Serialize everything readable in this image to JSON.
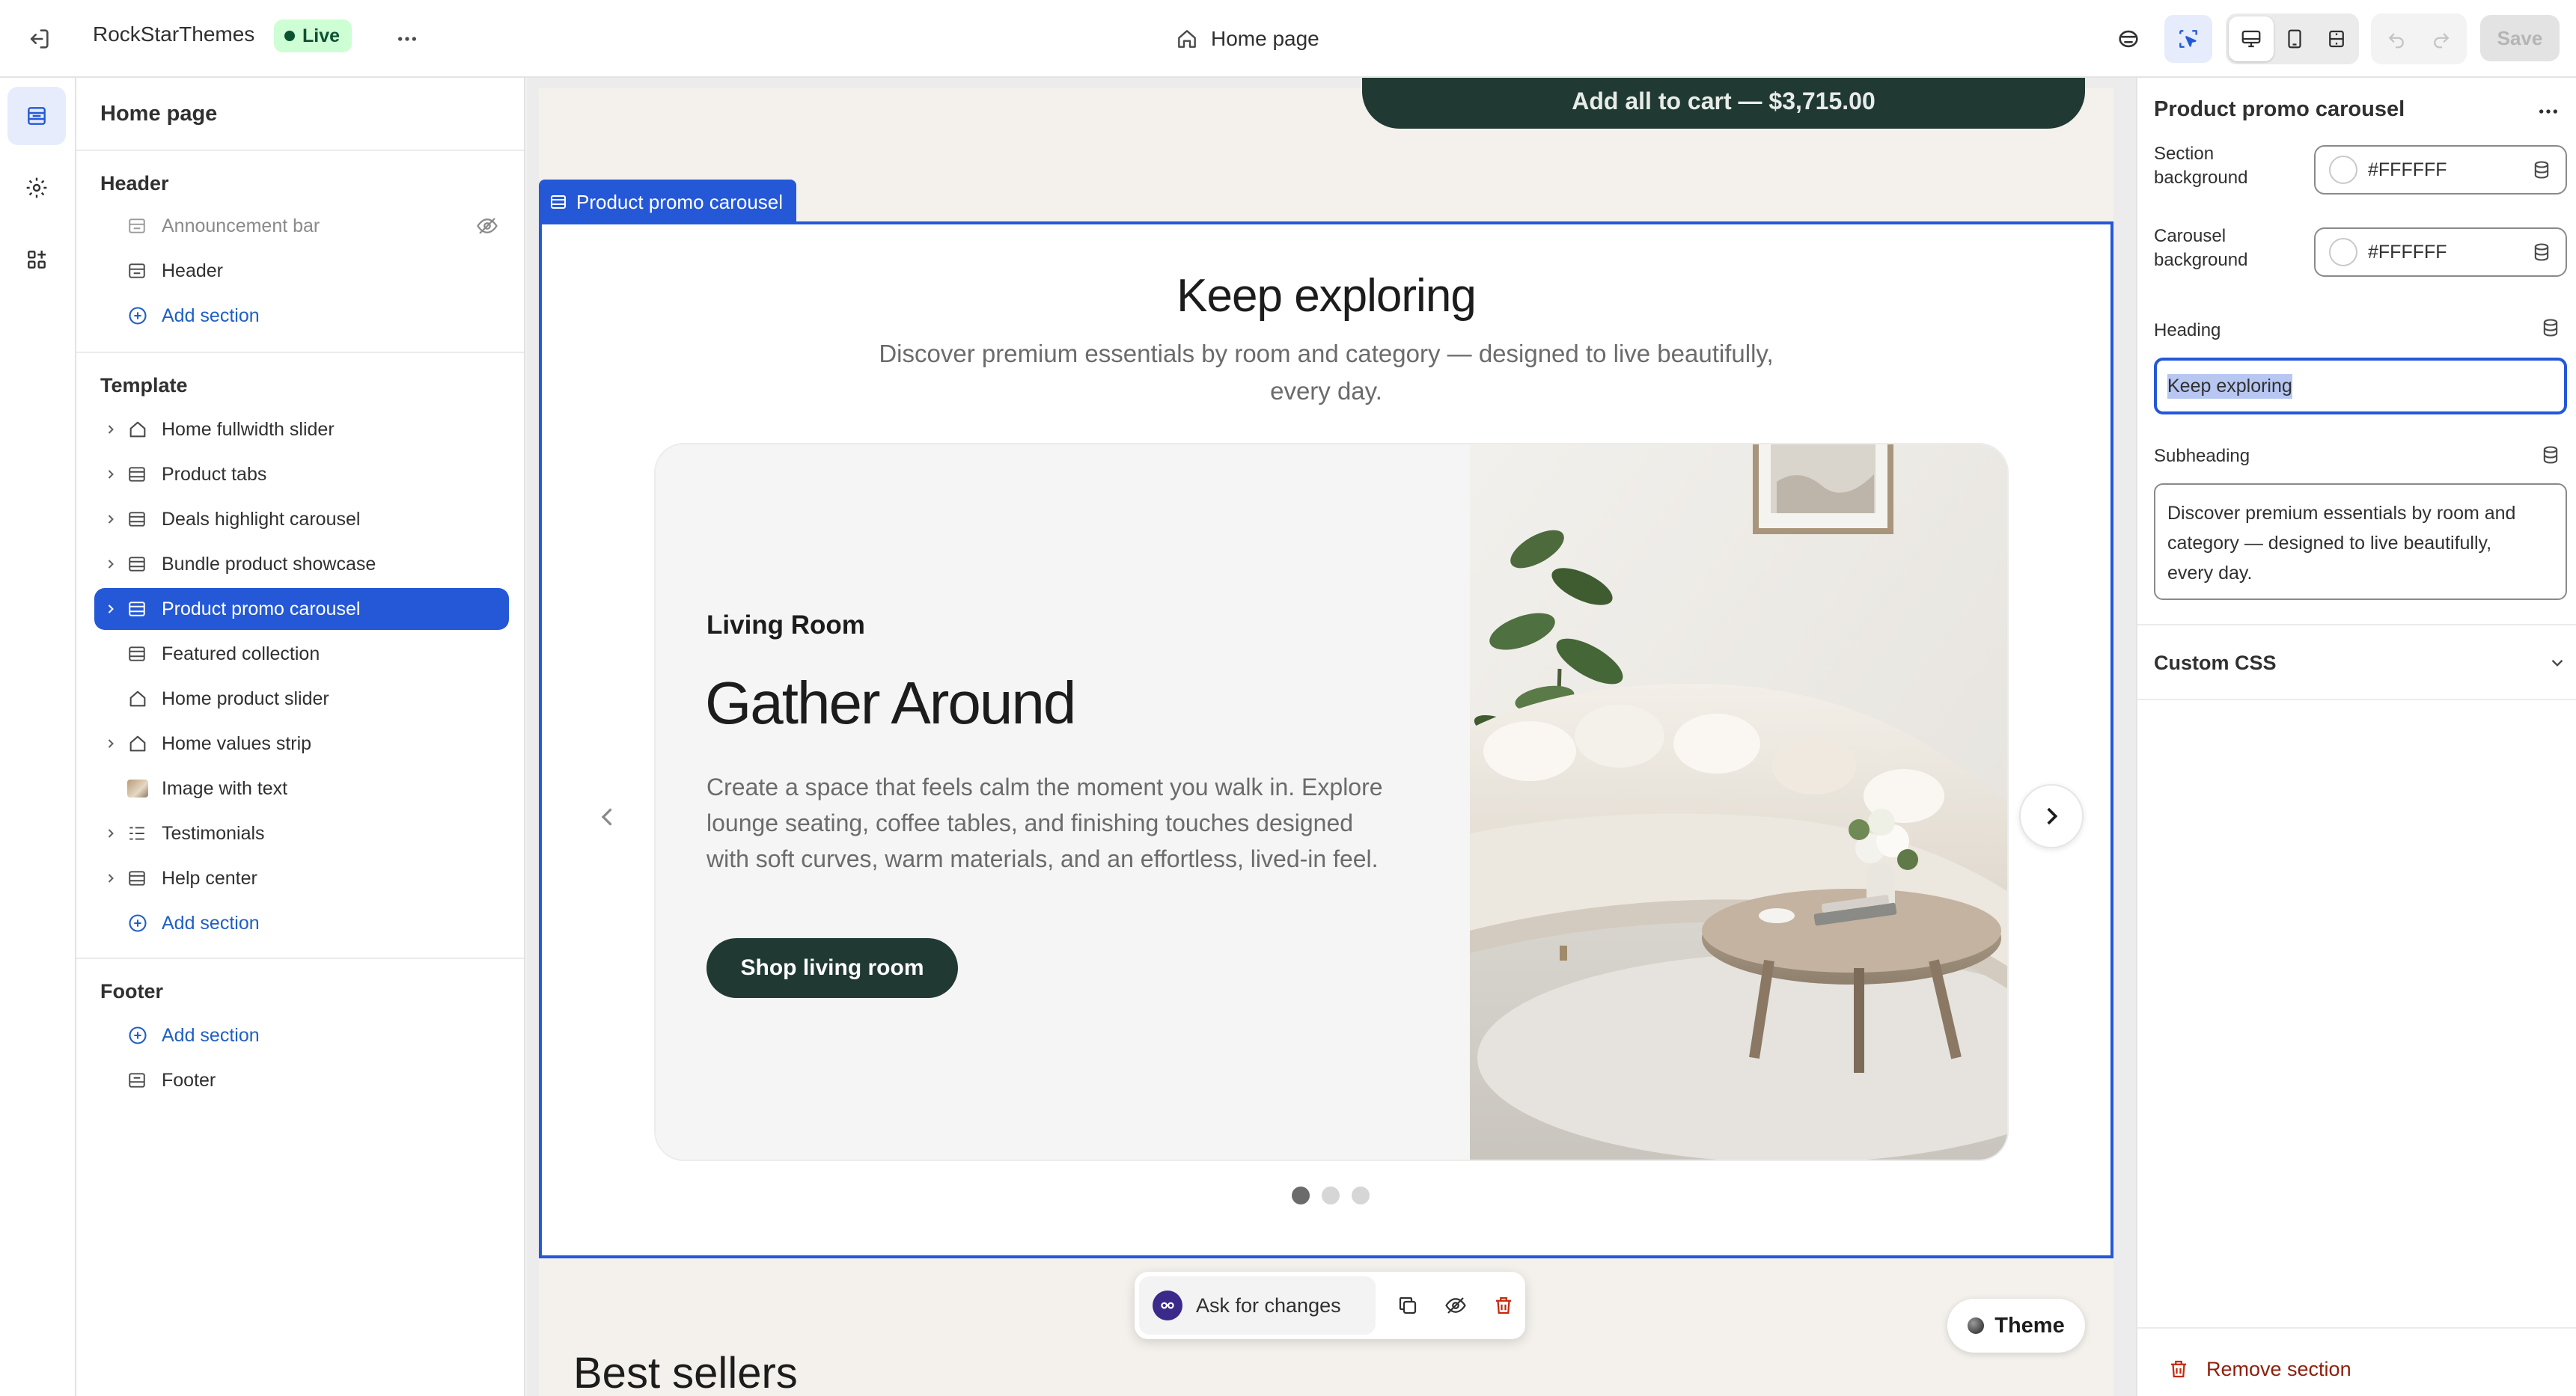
{
  "topbar": {
    "store_name": "RockStarThemes",
    "live_badge": "Live",
    "page_selector": "Home page",
    "save_label": "Save"
  },
  "sidebar": {
    "title": "Home page",
    "header_group": "Header",
    "header_items": [
      {
        "label": "Announcement bar"
      },
      {
        "label": "Header"
      }
    ],
    "add_section": "Add section",
    "template_group": "Template",
    "template_items": [
      {
        "label": "Home fullwidth slider"
      },
      {
        "label": "Product tabs"
      },
      {
        "label": "Deals highlight carousel"
      },
      {
        "label": "Bundle product showcase"
      },
      {
        "label": "Product promo carousel"
      },
      {
        "label": "Featured collection"
      },
      {
        "label": "Home product slider"
      },
      {
        "label": "Home values strip"
      },
      {
        "label": "Image with text"
      },
      {
        "label": "Testimonials"
      },
      {
        "label": "Help center"
      }
    ],
    "footer_group": "Footer",
    "footer_items": [
      {
        "label": "Footer"
      }
    ]
  },
  "canvas": {
    "section_tag": "Product promo carousel",
    "cart_button": "Add all to cart — $3,715.00",
    "heading": "Keep exploring",
    "subheading_line1": "Discover premium essentials by room and category — designed to live beautifully,",
    "subheading_line2": "every day.",
    "slide": {
      "eyebrow": "Living Room",
      "title": "Gather Around",
      "body_lines": [
        "Create a space that feels calm the moment you walk in. Explore",
        "lounge seating, coffee tables, and finishing touches designed",
        "with soft curves, warm materials, and an effortless, lived-in feel."
      ],
      "cta": "Shop living room"
    },
    "slide_count": 3,
    "active_slide": 1,
    "ask_changes": "Ask for changes",
    "theme_button": "Theme",
    "next_section_title": "Best sellers"
  },
  "panel": {
    "title": "Product promo carousel",
    "section_bg_label_1": "Section",
    "section_bg_label_2": "background",
    "section_bg_value": "#FFFFFF",
    "carousel_bg_label_1": "Carousel",
    "carousel_bg_label_2": "background",
    "carousel_bg_value": "#FFFFFF",
    "heading_label": "Heading",
    "heading_value": "Keep exploring",
    "subheading_label": "Subheading",
    "subheading_lines": [
      "Discover premium essentials by room and",
      "category — designed to live beautifully,",
      "every day."
    ],
    "custom_css": "Custom CSS",
    "remove_section": "Remove section"
  },
  "colors": {
    "accent_blue": "#2458d7",
    "live_green_bg": "#cdfed4",
    "dark_green": "#203a33",
    "danger": "#c5280c"
  }
}
